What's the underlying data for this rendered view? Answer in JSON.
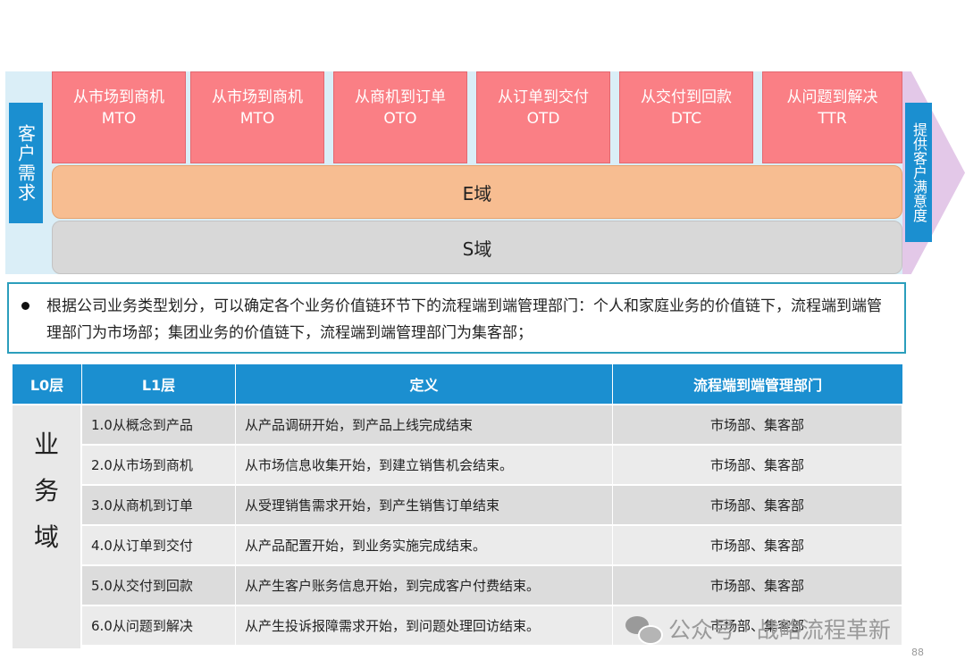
{
  "diagram": {
    "left_label": "客户需求",
    "right_label": "提供客户满意度",
    "stages": [
      {
        "name": "从市场到商机",
        "code": "MTO"
      },
      {
        "name": "从市场到商机",
        "code": "MTO"
      },
      {
        "name": "从商机到订单",
        "code": "OTO"
      },
      {
        "name": "从订单到交付",
        "code": "OTD"
      },
      {
        "name": "从交付到回款",
        "code": "DTC"
      },
      {
        "name": "从问题到解决",
        "code": "TTR"
      }
    ],
    "e_domain": "E域",
    "s_domain": "S域"
  },
  "description": "根据公司业务类型划分，可以确定各个业务价值链环节下的流程端到端管理部门：个人和家庭业务的价值链下，流程端到端管理部门为市场部；集团业务的价值链下，流程端到端管理部门为集客部；",
  "table": {
    "headers": [
      "L0层",
      "L1层",
      "定义",
      "流程端到端管理部门"
    ],
    "l0_chars": [
      "业",
      "务",
      "域"
    ],
    "rows": [
      {
        "l1": "1.0从概念到产品",
        "definition": "从产品调研开始，到产品上线完成结束",
        "dept": "市场部、集客部"
      },
      {
        "l1": "2.0从市场到商机",
        "definition": "从市场信息收集开始，到建立销售机会结束。",
        "dept": "市场部、集客部"
      },
      {
        "l1": "3.0从商机到订单",
        "definition": "从受理销售需求开始，到产生销售订单结束",
        "dept": "市场部、集客部"
      },
      {
        "l1": "4.0从订单到交付",
        "definition": "从产品配置开始，到业务实施完成结束。",
        "dept": "市场部、集客部"
      },
      {
        "l1": "5.0从交付到回款",
        "definition": "从产生客户账务信息开始，到完成客户付费结束。",
        "dept": "市场部、集客部"
      },
      {
        "l1": "6.0从问题到解决",
        "definition": "从产生投诉报障需求开始，到问题处理回访结束。",
        "dept": "市场部、集客部"
      }
    ]
  },
  "watermark": "公众号 · 战略流程革新",
  "page_number": "88",
  "colors": {
    "stage_fill": "#fa7f85",
    "e_domain": "#f7bd91",
    "s_domain": "#d8d8d8",
    "header_blue": "#1b8fd0",
    "band": "#daeef7",
    "arrow": "#e3c8e8"
  },
  "icons": {
    "watermark_icon": "wechat-icon"
  }
}
